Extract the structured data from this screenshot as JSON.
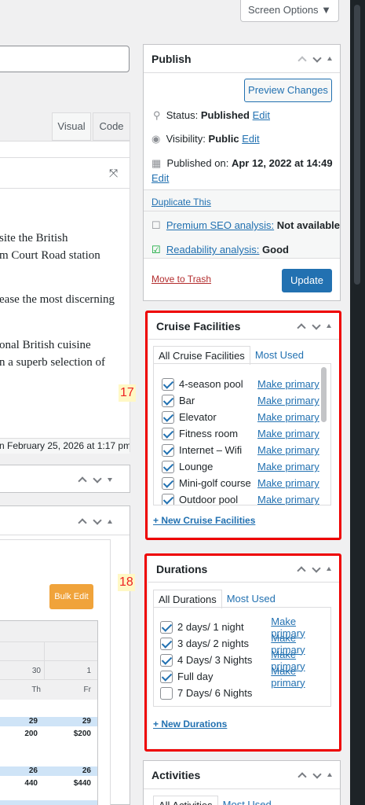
{
  "screen_options": "Screen Options ▼",
  "editor": {
    "tab_visual": "Visual",
    "tab_code": "Code",
    "lines": [
      "site the British",
      "m Court Road station",
      "ease the most discerning",
      "onal British cuisine",
      "n a superb selection of"
    ],
    "last_edited": "n February 25, 2026 at 1:17 pm"
  },
  "publish": {
    "title": "Publish",
    "preview_button": "Preview Changes",
    "status_label": "Status:",
    "status_value": "Published",
    "edit": "Edit",
    "visibility_label": "Visibility:",
    "visibility_value": "Public",
    "published_label": "Published on:",
    "published_value": "Apr 12, 2022 at 14:49",
    "duplicate": "Duplicate This",
    "seo_label": "Premium SEO analysis:",
    "seo_value": "Not available",
    "readability_label": "Readability analysis:",
    "readability_value": "Good",
    "trash": "Move to Trash",
    "update": "Update"
  },
  "cruise": {
    "badge": "17",
    "title": "Cruise Facilities",
    "tab_all": "All Cruise Facilities",
    "tab_most": "Most Used",
    "make_primary": "Make primary",
    "items": [
      "4-season pool",
      "Bar",
      "Elevator",
      "Fitness room",
      "Internet – Wifi",
      "Lounge",
      "Mini-golf course",
      "Outdoor pool"
    ],
    "add_new": "+ New Cruise Facilities"
  },
  "durations": {
    "badge": "18",
    "title": "Durations",
    "tab_all": "All Durations",
    "tab_most": "Most Used",
    "make_primary": "Make primary",
    "items": [
      {
        "label": "2 days/ 1 night",
        "checked": true
      },
      {
        "label": "3 days/ 2 nights",
        "checked": true
      },
      {
        "label": "4 Days/ 3 Nights",
        "checked": true
      },
      {
        "label": "Full day",
        "checked": true
      },
      {
        "label": "7 Days/ 6 Nights",
        "checked": false
      }
    ],
    "add_new": "+ New Durations"
  },
  "activities": {
    "title": "Activities",
    "tab_all": "All Activities",
    "tab_most": "Most Used"
  },
  "calendar": {
    "bulk_edit": "Bulk Edit",
    "days": [
      {
        "num": "30",
        "dow": "Th"
      },
      {
        "num": "1",
        "dow": "Fr"
      }
    ],
    "rows": [
      {
        "counts": [
          "29",
          "29"
        ],
        "prices": [
          "200",
          "$200"
        ]
      },
      {
        "counts": [
          "26",
          "26"
        ],
        "prices": [
          "440",
          "$440"
        ]
      }
    ]
  }
}
